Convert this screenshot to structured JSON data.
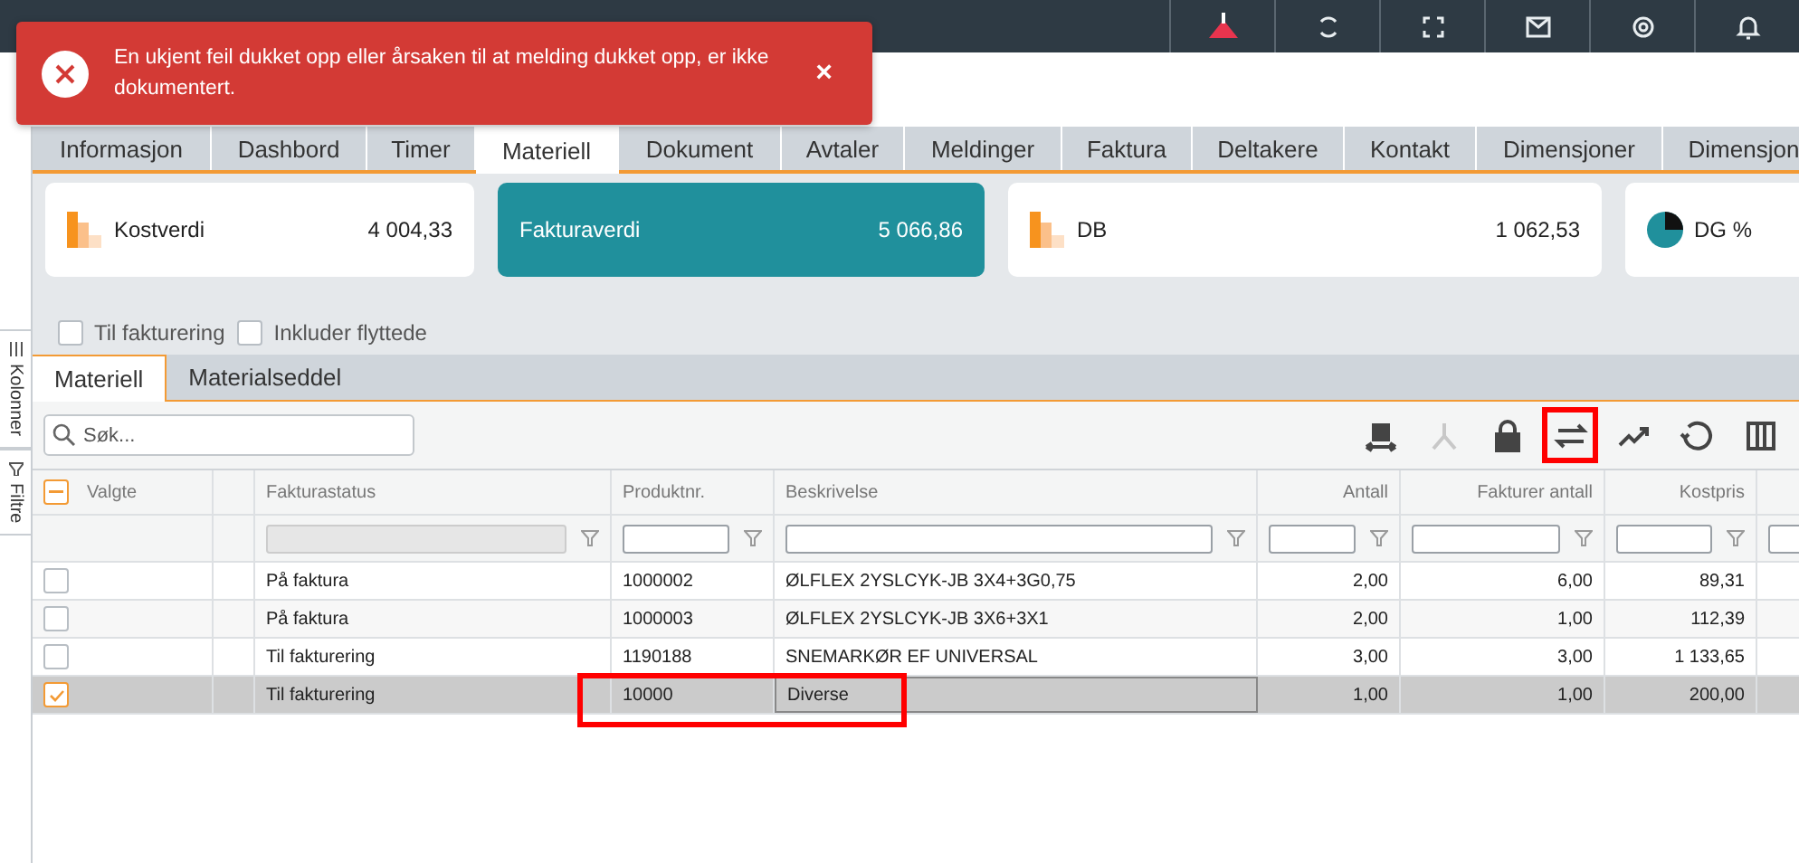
{
  "top_bar": {
    "icons": [
      {
        "kind": "triangle"
      },
      {
        "kind": "refresh"
      },
      {
        "kind": "fullscreen"
      },
      {
        "kind": "mail"
      },
      {
        "kind": "settings"
      },
      {
        "kind": "bell"
      }
    ]
  },
  "notification": {
    "message": "En ukjent feil dukket opp eller årsaken til at melding dukket opp, er ikke dokumentert.",
    "close": "×"
  },
  "side_tabs": [
    {
      "label": "Kolonner",
      "kind": "columns"
    },
    {
      "label": "Filtre",
      "kind": "filter"
    }
  ],
  "tabs": [
    {
      "label": "Informasjon",
      "selected": false
    },
    {
      "label": "Dashbord",
      "selected": false
    },
    {
      "label": "Timer",
      "selected": false
    },
    {
      "label": "Materiell",
      "selected": true
    },
    {
      "label": "Dokument",
      "selected": false
    },
    {
      "label": "Avtaler",
      "selected": false
    },
    {
      "label": "Meldinger",
      "selected": false
    },
    {
      "label": "Faktura",
      "selected": false
    },
    {
      "label": "Deltakere",
      "selected": false
    },
    {
      "label": "Kontakt",
      "selected": false
    },
    {
      "label": "Dimensjoner",
      "selected": false
    },
    {
      "label": "Dimensjon",
      "selected": false
    }
  ],
  "cards": [
    {
      "label": "Kostverdi",
      "value": "4 004,33",
      "kind": "bars",
      "highlighted": false
    },
    {
      "label": "Fakturaverdi",
      "value": "5 066,86",
      "kind": "plain",
      "highlighted": true
    },
    {
      "label": "DB",
      "value": "1 062,53",
      "kind": "bars",
      "highlighted": false
    },
    {
      "label": "DG %",
      "kind": "pie",
      "highlighted": false
    }
  ],
  "filters": [
    {
      "label": "Til fakturering",
      "checked": false
    },
    {
      "label": "Inkluder flyttede",
      "checked": false
    }
  ],
  "sub_tabs": [
    {
      "label": "Materiell",
      "selected": true
    },
    {
      "label": "Materialseddel",
      "selected": false
    }
  ],
  "search": {
    "placeholder": "Søk..."
  },
  "toolbar_icons": [
    {
      "kind": "move",
      "disabled": false,
      "highlighted": false
    },
    {
      "kind": "split",
      "disabled": true,
      "highlighted": false
    },
    {
      "kind": "lock",
      "disabled": false,
      "highlighted": false
    },
    {
      "kind": "swap",
      "disabled": false,
      "highlighted": true
    },
    {
      "kind": "trend",
      "disabled": false,
      "highlighted": false
    },
    {
      "kind": "history",
      "disabled": false,
      "highlighted": false
    },
    {
      "kind": "columns",
      "disabled": false,
      "highlighted": false
    }
  ],
  "table": {
    "select_all": {
      "indeterminate": true
    },
    "columns": [
      {
        "label": "Valgte",
        "filter": false,
        "right_aligned": false
      },
      {
        "filter": false
      },
      {
        "label": "Fakturastatus",
        "filter": true,
        "filter_disabled": true,
        "right_aligned": false
      },
      {
        "label": "Produktnr.",
        "filter": true,
        "filter_disabled": false,
        "right_aligned": false
      },
      {
        "label": "Beskrivelse",
        "filter": true,
        "filter_disabled": false,
        "right_aligned": false
      },
      {
        "label": "Antall",
        "filter": true,
        "filter_disabled": false,
        "right_aligned": true
      },
      {
        "label": "Fakturer antall",
        "filter": true,
        "filter_disabled": false,
        "right_aligned": true
      },
      {
        "label": "Kostpris",
        "filter": true,
        "filter_disabled": false,
        "right_aligned": true
      },
      {
        "filter": true,
        "filter_disabled": false
      }
    ],
    "rows": [
      {
        "selected": false,
        "editing": false,
        "highlighted": false,
        "cells": [
          "",
          "",
          "På faktura",
          "1000002",
          "ØLFLEX 2YSLCYK-JB 3X4+3G0,75",
          "2,00",
          "6,00",
          "89,31"
        ]
      },
      {
        "selected": false,
        "editing": false,
        "highlighted": false,
        "cells": [
          "",
          "",
          "På faktura",
          "1000003",
          "ØLFLEX 2YSLCYK-JB 3X6+3X1",
          "2,00",
          "1,00",
          "112,39"
        ]
      },
      {
        "selected": false,
        "editing": false,
        "highlighted": false,
        "cells": [
          "",
          "",
          "Til fakturering",
          "1190188",
          "SNEMARKØR EF UNIVERSAL",
          "3,00",
          "3,00",
          "1 133,65"
        ]
      },
      {
        "selected": true,
        "editing": true,
        "highlighted": true,
        "cells": [
          "",
          "",
          "Til fakturering",
          "10000",
          "Diverse",
          "1,00",
          "1,00",
          "200,00"
        ]
      }
    ]
  }
}
